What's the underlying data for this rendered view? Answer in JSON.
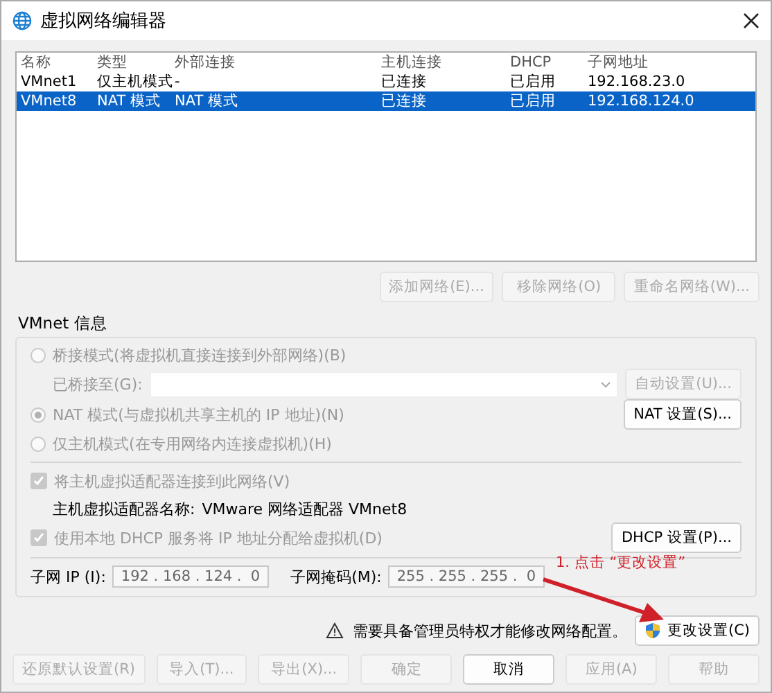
{
  "window": {
    "title": "虚拟网络编辑器"
  },
  "table": {
    "columns": [
      "名称",
      "类型",
      "外部连接",
      "主机连接",
      "DHCP",
      "子网地址"
    ],
    "rows": [
      {
        "cells": [
          "VMnet1",
          "仅主机模式",
          "-",
          "已连接",
          "已启用",
          "192.168.23.0"
        ],
        "selected": false
      },
      {
        "cells": [
          "VMnet8",
          "NAT 模式",
          "NAT 模式",
          "已连接",
          "已启用",
          "192.168.124.0"
        ],
        "selected": true
      }
    ]
  },
  "list_buttons": [
    {
      "label": "添加网络(E)...",
      "disabled": true
    },
    {
      "label": "移除网络(O)",
      "disabled": true
    },
    {
      "label": "重命名网络(W)...",
      "disabled": true
    }
  ],
  "vmnet_info": {
    "title": "VMnet 信息",
    "bridged": {
      "label": "桥接模式(将虚拟机直接连接到外部网络)(B)",
      "selected": false,
      "disabled": true
    },
    "bridged_to": {
      "label": "已桥接至(G):",
      "button": {
        "label": "自动设置(U)...",
        "disabled": true
      }
    },
    "nat": {
      "label": "NAT 模式(与虚拟机共享主机的 IP 地址)(N)",
      "selected": true,
      "disabled": true,
      "button": {
        "label": "NAT 设置(S)...",
        "disabled": false
      }
    },
    "host_only": {
      "label": "仅主机模式(在专用网络内连接虚拟机)(H)",
      "selected": false,
      "disabled": true
    },
    "connect_adapter": {
      "label": "将主机虚拟适配器连接到此网络(V)",
      "checked": true,
      "disabled": true
    },
    "adapter_name": {
      "label": "主机虚拟适配器名称:",
      "value": "VMware 网络适配器 VMnet8"
    },
    "dhcp": {
      "label": "使用本地 DHCP 服务将 IP 地址分配给虚拟机(D)",
      "checked": true,
      "disabled": true,
      "button": {
        "label": "DHCP 设置(P)...",
        "disabled": false
      }
    },
    "subnet_ip": {
      "label": "子网 IP (I):",
      "value": "192 . 168 . 124 .  0"
    },
    "subnet_mask": {
      "label": "子网掩码(M):",
      "value": "255 . 255 . 255 .  0"
    }
  },
  "annotation": {
    "text": "1. 点击 “更改设置”"
  },
  "warning": {
    "text": "需要具备管理员特权才能修改网络配置。",
    "button": {
      "label": "更改设置(C)"
    }
  },
  "footer_buttons": [
    {
      "label": "还原默认设置(R)",
      "disabled": true
    },
    {
      "label": "导入(T)...",
      "disabled": true
    },
    {
      "label": "导出(X)...",
      "disabled": true
    },
    {
      "label": "确定",
      "disabled": true
    },
    {
      "label": "取消",
      "disabled": false
    },
    {
      "label": "应用(A)",
      "disabled": true
    },
    {
      "label": "帮助",
      "disabled": true
    }
  ]
}
